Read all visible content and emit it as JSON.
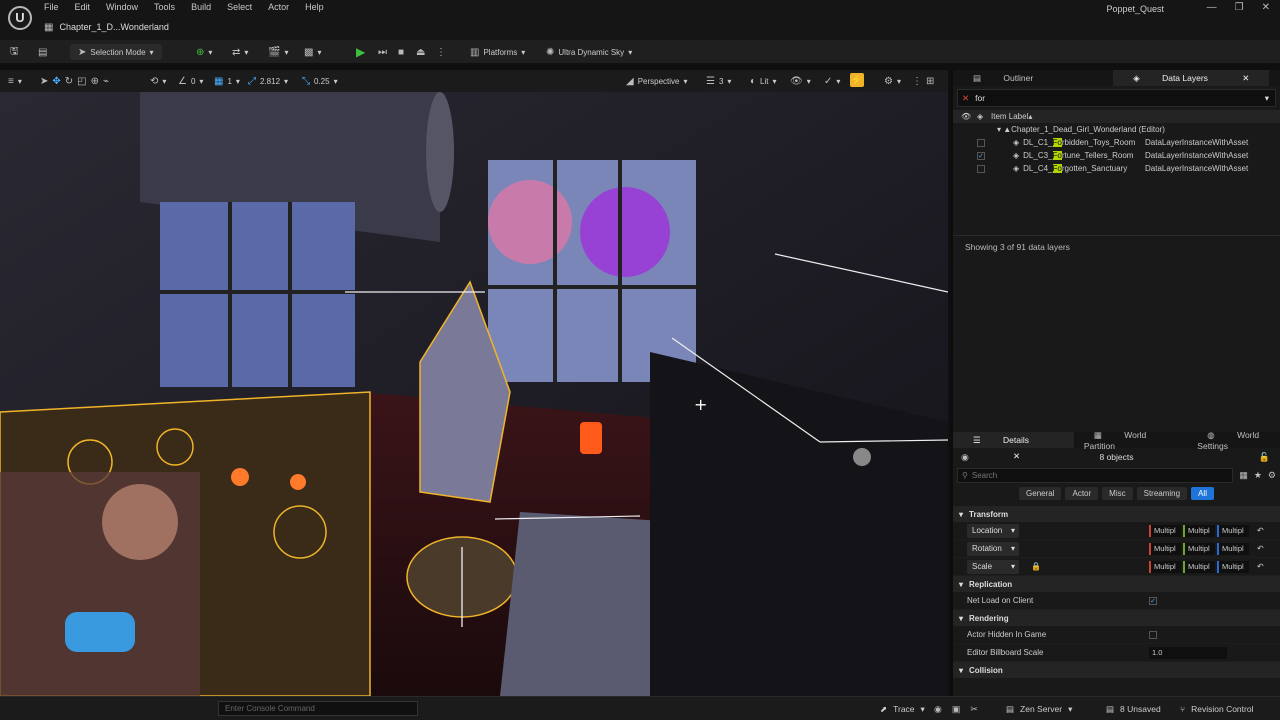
{
  "menubar": {
    "items": [
      "File",
      "Edit",
      "Window",
      "Tools",
      "Build",
      "Select",
      "Actor",
      "Help"
    ],
    "level_tab": "Chapter_1_D...Wonderland",
    "project_name": "Poppet_Quest"
  },
  "toolbar": {
    "selection_mode": "Selection Mode",
    "platforms": "Platforms",
    "sky": "Ultra Dynamic Sky"
  },
  "viewport_toolbar": {
    "rot_snap": "0",
    "scale_snap": "1",
    "camera_speed": "2.812",
    "grid_value": "0.25",
    "perspective": "Perspective",
    "layout": "3",
    "lit": "Lit"
  },
  "outliner": {
    "tabs": [
      "Outliner",
      "Data Layers"
    ],
    "filter_value": "for",
    "column_header": "Item Label",
    "root_item": "Chapter_1_Dead_Girl_Wonderland (Editor)",
    "rows": [
      {
        "prefix": "DL_C1_",
        "match": "Fo",
        "suffix": "rbidden_Toys_Room",
        "type": "DataLayerInstanceWithAsset",
        "checked": false
      },
      {
        "prefix": "DL_C3_",
        "match": "Fo",
        "suffix": "rtune_Tellers_Room",
        "type": "DataLayerInstanceWithAsset",
        "checked": true
      },
      {
        "prefix": "DL_C4_",
        "match": "Fo",
        "suffix": "rgotten_Sanctuary",
        "type": "DataLayerInstanceWithAsset",
        "checked": false
      }
    ],
    "status": "Showing 3 of 91 data layers"
  },
  "details": {
    "tabs": [
      "Details",
      "World Partition",
      "World Settings"
    ],
    "object_count": "8 objects",
    "search_placeholder": "Search",
    "categories": [
      "General",
      "Actor",
      "Misc",
      "Streaming",
      "All"
    ],
    "selected_category": "All",
    "sections": {
      "transform": "Transform",
      "replication": "Replication",
      "rendering": "Rendering",
      "collision": "Collision"
    },
    "transform_rows": [
      "Location",
      "Rotation",
      "Scale"
    ],
    "multi_value": "Multipl",
    "net_load_label": "Net Load on Client",
    "actor_hidden_label": "Actor Hidden In Game",
    "billboard_label": "Editor Billboard Scale",
    "billboard_value": "1.0"
  },
  "statusbar": {
    "console_placeholder": "Enter Console Command",
    "trace": "Trace",
    "zen": "Zen Server",
    "unsaved": "8 Unsaved",
    "revision": "Revision Control"
  },
  "colors": {
    "selection_outline": "#f0b429",
    "accent_blue": "#1e74d8",
    "filter_highlight": "#b5d400",
    "play_green": "#3fbf3f"
  }
}
